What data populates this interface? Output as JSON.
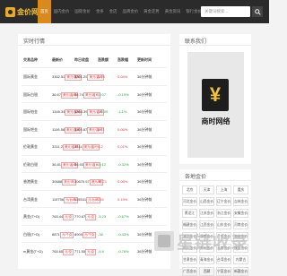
{
  "header": {
    "logo_text": "金价网",
    "nav": [
      "首页",
      "国内金价",
      "国际金价",
      "金条",
      "金店",
      "品牌金价",
      "黄金走势",
      "黄金资讯",
      "银行金价",
      "首饰金价"
    ],
    "search_placeholder": "关键词搜索..."
  },
  "main": {
    "title": "实时行情",
    "columns": [
      "交易品种",
      "最新价",
      "昨日收盘",
      "涨跌额",
      "涨跌幅",
      "更新时间"
    ],
    "rows": [
      {
        "name": "国际黄金",
        "price": "3302.52",
        "price_unit": "美元/盎司",
        "prev": "3301.29",
        "prev_unit": "美元/盎司",
        "chg": "1.23",
        "pct": "0.04%",
        "time": "36分钟前",
        "dir": "up"
      },
      {
        "name": "国际白银",
        "price": "36.67",
        "price_unit": "美元/盎司",
        "prev": "36.74",
        "price_unit2": "",
        "prev_unit": "美元/盎司",
        "chg": "-0.07",
        "pct": "-0.19%",
        "time": "36分钟前",
        "dir": "down"
      },
      {
        "name": "国际铂金",
        "price": "1349.34",
        "price_unit": "美元/盎司",
        "prev": "1364.39",
        "prev_unit": "美元/盎司",
        "chg": "-15.05",
        "pct": "-1.1%",
        "time": "36分钟前",
        "dir": "down"
      },
      {
        "name": "国际钯金",
        "price": "1106.58",
        "price_unit": "美元/盎司",
        "prev": "1105.87",
        "prev_unit": "美元/盎司",
        "chg": "0.71",
        "pct": "0.06%",
        "time": "36分钟前",
        "dir": "up"
      },
      {
        "name": "伦敦黄金",
        "price": "3311.2",
        "price_unit": "美元/盎司",
        "prev": "3311",
        "prev_unit": "美元/盎司",
        "chg": "0.2",
        "pct": "0.01%",
        "time": "36分钟前",
        "dir": "up"
      },
      {
        "name": "伦敦白银",
        "price": "36.81",
        "price_unit": "美元/盎司",
        "prev": "36.93",
        "prev_unit": "美元/盎司",
        "chg": "-0.12",
        "pct": "-0.32%",
        "time": "36分钟前",
        "dir": "down"
      },
      {
        "name": "香港黄金",
        "price": "30688",
        "price_unit": "港元/两",
        "prev": "30670.97",
        "prev_unit": "港元/两",
        "chg": "17.71",
        "pct": "0.06%",
        "time": "36分钟前",
        "dir": "up"
      },
      {
        "name": "台湾黄金",
        "price": "115756",
        "price_unit": "元/台两",
        "prev": "115541",
        "prev_unit": "元/台两",
        "chg": "215",
        "pct": "0.19%",
        "time": "36分钟前",
        "dir": "up"
      },
      {
        "name": "黄金(T+D)",
        "price": "765.44",
        "price_unit": "元/克",
        "prev": "770.67",
        "prev_unit": "元/克",
        "chg": "-5.23",
        "pct": "-0.67%",
        "time": "36分钟前",
        "dir": "down"
      },
      {
        "name": "白银(T+D)",
        "price": "8871",
        "price_unit": "元/千克",
        "prev": "8909",
        "prev_unit": "元/千克",
        "chg": "-38",
        "pct": "-0.43%",
        "time": "36分钟前",
        "dir": "down"
      },
      {
        "name": "m黄金(T+D)",
        "price": "765.65",
        "price_unit": "元/克",
        "prev": "771.55",
        "prev_unit": "元/克",
        "chg": "-5.9",
        "pct": "-0.76%",
        "time": "36分钟前",
        "dir": "down"
      }
    ]
  },
  "side_contact": {
    "title": "联系我们",
    "ad_symbol": "¥",
    "ad_text": "商时网络"
  },
  "side_tags": {
    "title": "各地金价",
    "items": [
      "北京",
      "天津",
      "上海",
      "重庆",
      "河北金价",
      "山西金价",
      "辽宁金价",
      "吉林金价",
      "黑龙江",
      "江苏金价",
      "浙江金价",
      "安徽金价",
      "福建金价",
      "江西金价",
      "山东金价",
      "河南金价",
      "湖北金价",
      "湖南金价",
      "广东金价",
      "海南金价",
      "四川金价",
      "贵州金价",
      "云南金价",
      "陕西金价",
      "甘肃金价",
      "青海金价",
      "台湾金价",
      "内蒙古",
      "广西金价",
      "西藏",
      "宁夏金价",
      "新疆金价"
    ]
  },
  "watermark": {
    "text": "星链收录"
  }
}
